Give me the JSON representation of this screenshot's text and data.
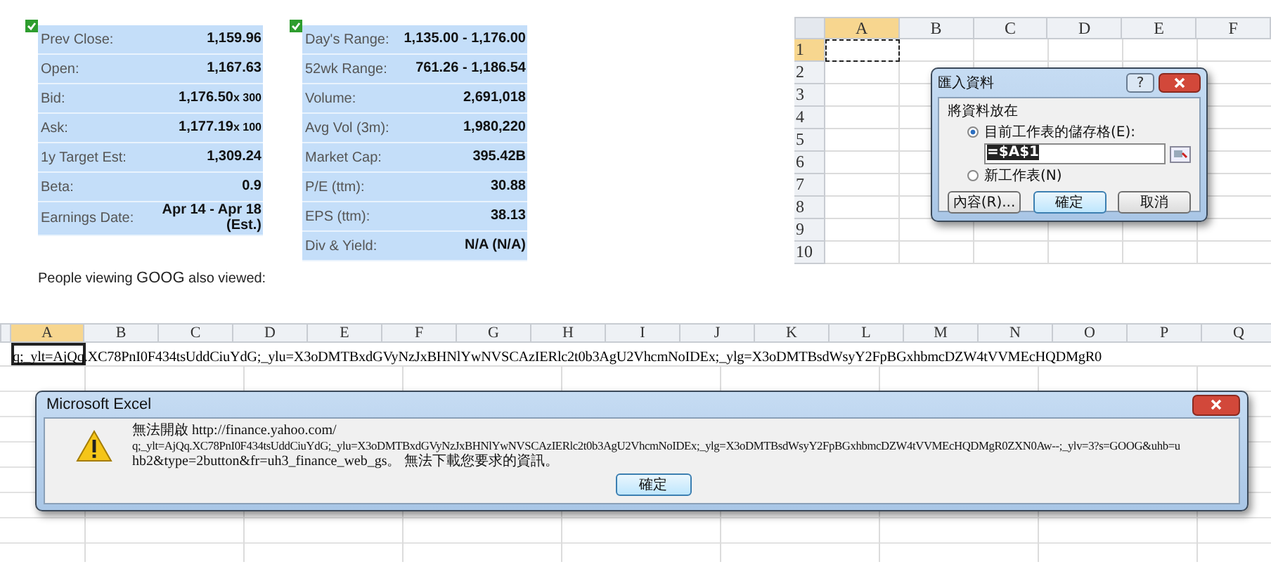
{
  "quote_summary": {
    "tables": [
      {
        "checked": true,
        "rows": [
          {
            "label": "Prev Close:",
            "value": "1,159.96"
          },
          {
            "label": "Open:",
            "value": "1,167.63"
          },
          {
            "label": "Bid:",
            "value": "1,176.50",
            "suffix": "x 300"
          },
          {
            "label": "Ask:",
            "value": "1,177.19",
            "suffix": "x 100"
          },
          {
            "label": "1y Target Est:",
            "value": "1,309.24"
          },
          {
            "label": "Beta:",
            "value": "0.9"
          },
          {
            "label": "Earnings Date:",
            "value": "Apr 14 - Apr 18 (Est.)"
          }
        ]
      },
      {
        "checked": true,
        "rows": [
          {
            "label": "Day's Range:",
            "value": "1,135.00 - 1,176.00"
          },
          {
            "label": "52wk Range:",
            "value": "761.26 - 1,186.54"
          },
          {
            "label": "Volume:",
            "value": "2,691,018"
          },
          {
            "label": "Avg Vol (3m):",
            "value": "1,980,220"
          },
          {
            "label": "Market Cap:",
            "value": "395.42B"
          },
          {
            "label": "P/E (ttm):",
            "value": "30.88"
          },
          {
            "label": "EPS (ttm):",
            "value": "38.13"
          },
          {
            "label": "Div & Yield:",
            "value": "N/A (N/A)"
          }
        ]
      }
    ],
    "footer": "People viewing **GOOG** also viewed:"
  },
  "sheet_top": {
    "columns": [
      {
        "label": "A",
        "selected": true
      },
      {
        "label": "B",
        "selected": false
      },
      {
        "label": "C",
        "selected": false
      },
      {
        "label": "D",
        "selected": false
      },
      {
        "label": "E",
        "selected": false
      },
      {
        "label": "F",
        "selected": false
      }
    ],
    "rows": [
      {
        "label": "1",
        "selected": true
      },
      {
        "label": "2",
        "selected": false
      },
      {
        "label": "3",
        "selected": false
      },
      {
        "label": "4",
        "selected": false
      },
      {
        "label": "5",
        "selected": false
      },
      {
        "label": "6",
        "selected": false
      },
      {
        "label": "7",
        "selected": false
      },
      {
        "label": "8",
        "selected": false
      },
      {
        "label": "9",
        "selected": false
      },
      {
        "label": "10",
        "selected": false
      }
    ]
  },
  "import_dialog": {
    "title": "匯入資料",
    "help": "?",
    "group_label": "將資料放在",
    "options": [
      {
        "label": "目前工作表的儲存格(E):",
        "selected": true
      },
      {
        "label": "新工作表(N)",
        "selected": false
      }
    ],
    "cell_reference": "=$A$1",
    "buttons": [
      "內容(R)...",
      "確定",
      "取消"
    ]
  },
  "sheet_bottom": {
    "columns": [
      {
        "label": "A",
        "selected": true
      },
      {
        "label": "B",
        "selected": false
      },
      {
        "label": "C",
        "selected": false
      },
      {
        "label": "D",
        "selected": false
      },
      {
        "label": "E",
        "selected": false
      },
      {
        "label": "F",
        "selected": false
      },
      {
        "label": "G",
        "selected": false
      },
      {
        "label": "H",
        "selected": false
      },
      {
        "label": "I",
        "selected": false
      },
      {
        "label": "J",
        "selected": false
      },
      {
        "label": "K",
        "selected": false
      },
      {
        "label": "L",
        "selected": false
      },
      {
        "label": "M",
        "selected": false
      },
      {
        "label": "N",
        "selected": false
      },
      {
        "label": "O",
        "selected": false
      },
      {
        "label": "P",
        "selected": false
      },
      {
        "label": "Q",
        "selected": false
      }
    ],
    "cell_a1": "q;_ylt=AjQq.XC78PnI0F434tsUddCiuYdG;_ylu=X3oDMTBxdGVyNzJxBHNlYwNVSCAzIERlc2t0b3AgU2VhcmNoIDEx;_ylg=X3oDMTBsdWsyY2FpBGxhbmcDZW4tVVMEcHQDMgR0"
  },
  "message_box": {
    "title": "Microsoft Excel",
    "lines": [
      "無法開啟 http://finance.yahoo.com/",
      "q;_ylt=AjQq.XC78PnI0F434tsUddCiuYdG;_ylu=X3oDMTBxdGVyNzJxBHNlYwNVSCAzIERlc2t0b3AgU2VhcmNoIDEx;_ylg=X3oDMTBsdWsyY2FpBGxhbmcDZW4tVVMEcHQDMgR0ZXN0Aw--;_ylv=3?s=GOOG&uhb=u",
      "hb2&type=2button&fr=uh3_finance_web_gs。 無法下載您要求的資訊。"
    ],
    "button": "確定"
  }
}
